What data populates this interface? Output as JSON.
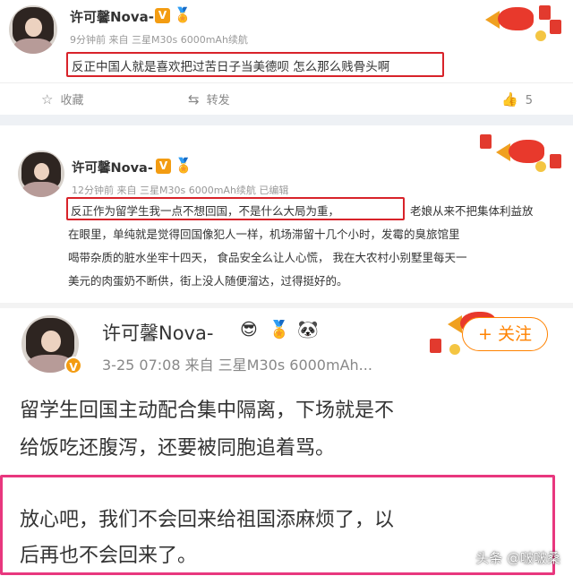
{
  "post1": {
    "username": "许可馨Nova-",
    "v_badge": "V",
    "medal_emoji": "🏅",
    "meta": "9分钟前  来自 三星M30s 6000mAh续航",
    "text": "反正中国人就是喜欢把过苦日子当美德呗 怎么那么贱骨头啊",
    "actions": {
      "favorite": {
        "icon": "star-icon",
        "glyph": "☆",
        "label": "收藏"
      },
      "repost": {
        "icon": "repost-icon",
        "glyph": "⇆",
        "label": "转发"
      },
      "like": {
        "icon": "thumb-up-icon",
        "glyph": "👍",
        "label": "5"
      }
    }
  },
  "post2": {
    "username": "许可馨Nova-",
    "v_badge": "V",
    "medal_emoji": "🏅",
    "meta": "12分钟前  来自 三星M30s 6000mAh续航  已编辑",
    "highlight": "反正作为留学生我一点不想回国，不是什么大局为重，",
    "lines": [
      "老娘从来不把集体利益放",
      "在眼里，单纯就是觉得回国像犯人一样，机场滞留十几个小时，发霉的臭旅馆里",
      "喝带杂质的脏水坐牢十四天，  食品安全么让人心慌，  我在大农村小别墅里每天一",
      "美元的肉蛋奶不断供，街上没人随便溜达，过得挺好的。"
    ]
  },
  "post3": {
    "username": "许可馨Nova-",
    "emoji_badges": [
      "😎",
      "🏅",
      "🐼"
    ],
    "v_badge": "V",
    "meta": "3-25 07:08  来自 三星M30s 6000mAh...",
    "follow_label": "+ 关注",
    "text_lines": [
      "留学生回国主动配合集中隔离，下场就是不",
      "给饭吃还腹泻，还要被同胞追着骂。"
    ],
    "highlight_lines": [
      "放心吧，我们不会回来给祖国添麻烦了，以",
      "后再也不会回来了。"
    ]
  },
  "watermark": "头条 @啵啵桑",
  "colors": {
    "highlight_red": "#d8232a",
    "highlight_pink": "#e8377e",
    "weibo_orange": "#ff8200",
    "meta_gray": "#999999"
  }
}
